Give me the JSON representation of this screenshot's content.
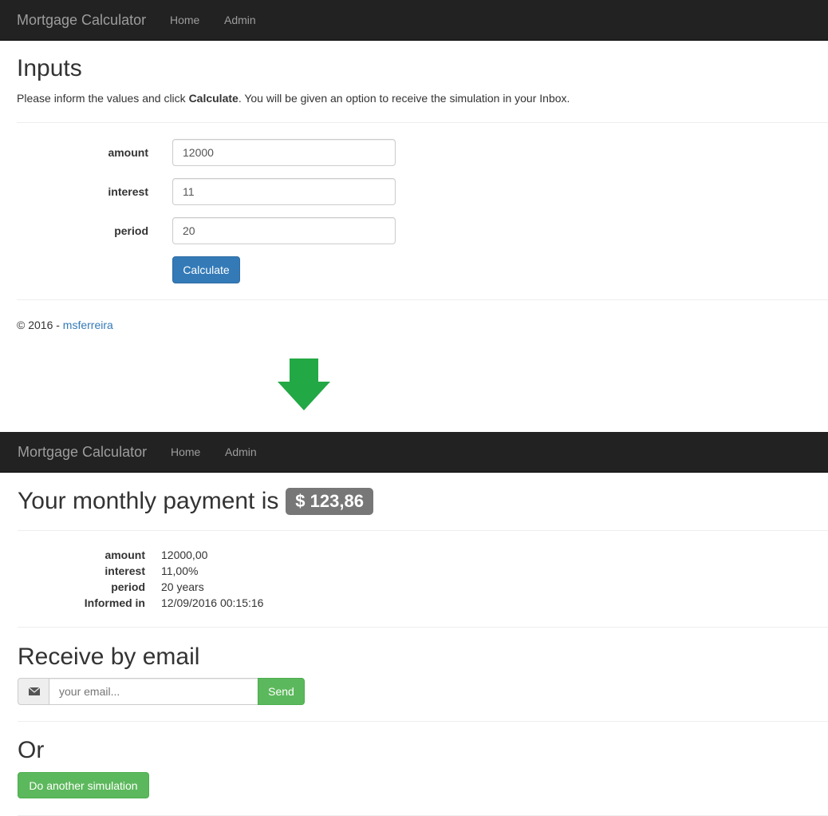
{
  "top": {
    "navbar": {
      "brand": "Mortgage Calculator",
      "links": [
        "Home",
        "Admin"
      ]
    },
    "page_title": "Inputs",
    "intro": {
      "before": "Please inform the values and click ",
      "bold": "Calculate",
      "after": ". You will be given an option to receive the simulation in your Inbox."
    },
    "form": {
      "fields": [
        {
          "label": "amount",
          "value": "12000"
        },
        {
          "label": "interest",
          "value": "11"
        },
        {
          "label": "period",
          "value": "20"
        }
      ],
      "submit_label": "Calculate"
    },
    "footer": {
      "copyright": "© 2016 - ",
      "author": "msferreira"
    }
  },
  "arrow": {
    "icon": "arrow-down-icon",
    "color": "#22a845"
  },
  "bottom": {
    "navbar": {
      "brand": "Mortgage Calculator",
      "links": [
        "Home",
        "Admin"
      ]
    },
    "result_title": "Your monthly payment is",
    "payment_badge": "$ 123,86",
    "details": [
      {
        "term": "amount",
        "value": "12000,00"
      },
      {
        "term": "interest",
        "value": "11,00%"
      },
      {
        "term": "period",
        "value": "20 years"
      },
      {
        "term": "Informed in",
        "value": "12/09/2016 00:15:16"
      }
    ],
    "email_section": {
      "title": "Receive by email",
      "icon": "envelope-icon",
      "placeholder": "your email...",
      "send_label": "Send"
    },
    "or_section": {
      "title": "Or",
      "button_label": "Do another simulation"
    }
  },
  "colors": {
    "navbar_bg": "#222222",
    "nav_text": "#9d9d9d",
    "primary": "#337ab7",
    "success": "#5cb85c",
    "badge_bg": "#777777",
    "link": "#337ab7"
  }
}
